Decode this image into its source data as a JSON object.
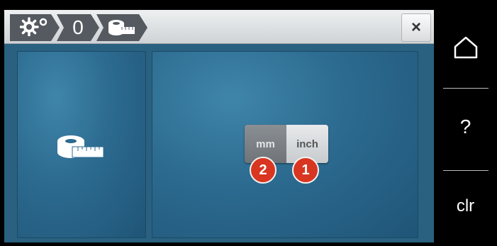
{
  "colors": {
    "topbar": "#d9dcdf",
    "main_bg": "#2a6180",
    "panel": "#2c6a8f",
    "crumb": "#555a60",
    "badge": "#d83620",
    "sidebar": "#000000"
  },
  "breadcrumb": {
    "items": [
      {
        "icon": "settings-gears-icon"
      },
      {
        "label": "0"
      },
      {
        "icon": "tape-measure-icon"
      }
    ]
  },
  "toolbar": {
    "close_label": "×"
  },
  "left_panel": {
    "icon": "tape-measure-icon"
  },
  "unit_toggle": {
    "options": [
      {
        "label": "mm",
        "badge": "2",
        "selected": false
      },
      {
        "label": "inch",
        "badge": "1",
        "selected": true
      }
    ]
  },
  "sidebar": {
    "home_icon": "home-icon",
    "help_label": "?",
    "clear_label": "clr"
  }
}
